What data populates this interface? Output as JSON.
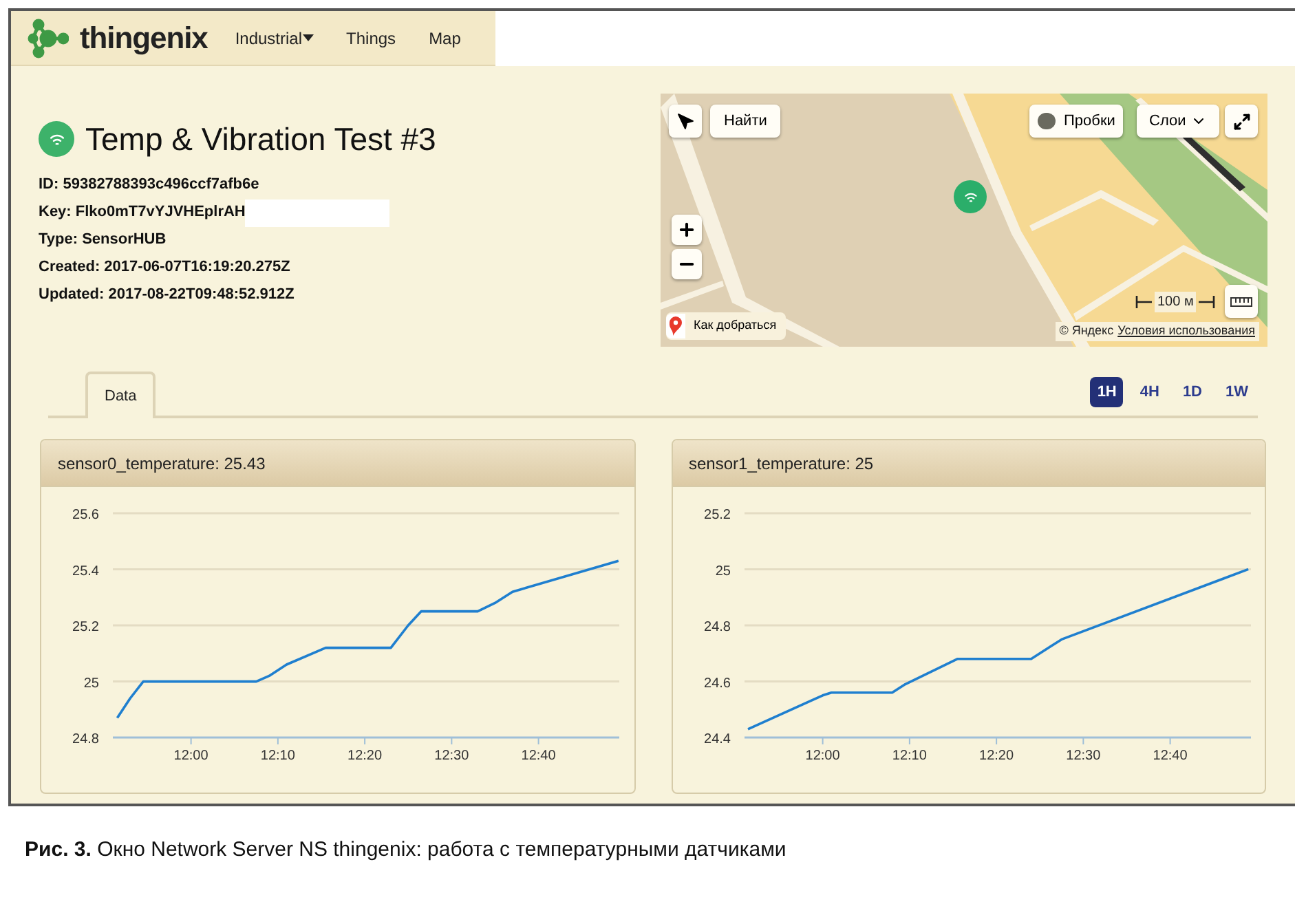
{
  "navbar": {
    "brand": "thingenix",
    "menu": [
      {
        "label": "Industrial",
        "dropdown": true
      },
      {
        "label": "Things",
        "dropdown": false
      },
      {
        "label": "Map",
        "dropdown": false
      }
    ]
  },
  "device": {
    "title": "Temp & Vibration Test #3",
    "online": true,
    "fields": [
      {
        "text": "ID: 59382788393c496ccf7afb6e",
        "redacted": false
      },
      {
        "text": "Key: Flko0mT7vYJVHEplrAH",
        "redacted": true
      },
      {
        "text": "Type: SensorHUB",
        "redacted": false
      },
      {
        "text": "Created: 2017-06-07T16:19:20.275Z",
        "redacted": false
      },
      {
        "text": "Updated: 2017-08-22T09:48:52.912Z",
        "redacted": false
      }
    ]
  },
  "map": {
    "search_button": "Найти",
    "traffic_button": "Пробки",
    "layers_button": "Слои",
    "route_button": "Как добраться",
    "scale": "100 м",
    "copyright": "© Яндекс",
    "terms_link": "Условия использования"
  },
  "tabs": [
    {
      "label": "Data",
      "selected": true
    }
  ],
  "range_buttons": [
    {
      "label": "1H",
      "selected": true
    },
    {
      "label": "4H",
      "selected": false
    },
    {
      "label": "1D",
      "selected": false
    },
    {
      "label": "1W",
      "selected": false
    }
  ],
  "charts": [
    {
      "title": "sensor0_temperature: 25.43",
      "chart_data": {
        "type": "line",
        "grid": true,
        "x": [
          711.5,
          713,
          714.5,
          727.5,
          729,
          731,
          735.5,
          743,
          745,
          746.5,
          753,
          755,
          757,
          769.2
        ],
        "series": [
          {
            "color": "#1f7fcf",
            "values": [
              24.87,
              24.94,
              25.0,
              25.0,
              25.02,
              25.06,
              25.12,
              25.12,
              25.2,
              25.25,
              25.25,
              25.28,
              25.32,
              25.43
            ]
          }
        ],
        "xlim": [
          711,
          769.3
        ],
        "ylim": [
          24.8,
          25.6
        ],
        "yticks": [
          {
            "value": 24.8,
            "label": "24.8"
          },
          {
            "value": 25,
            "label": "25"
          },
          {
            "value": 25.2,
            "label": "25.2"
          },
          {
            "value": 25.4,
            "label": "25.4"
          },
          {
            "value": 25.6,
            "label": "25.6"
          }
        ],
        "xticks": [
          {
            "value": 720,
            "label": "12:00"
          },
          {
            "value": 730,
            "label": "12:10"
          },
          {
            "value": 740,
            "label": "12:20"
          },
          {
            "value": 750,
            "label": "12:30"
          },
          {
            "value": 760,
            "label": "12:40"
          }
        ]
      }
    },
    {
      "title": "sensor1_temperature: 25",
      "chart_data": {
        "type": "line",
        "grid": true,
        "x": [
          711.4,
          720,
          721,
          728,
          729.5,
          735.5,
          744,
          747.5,
          769
        ],
        "series": [
          {
            "color": "#1f7fcf",
            "values": [
              24.43,
              24.55,
              24.56,
              24.56,
              24.59,
              24.68,
              24.68,
              24.75,
              25.0
            ]
          }
        ],
        "xlim": [
          711,
          769.3
        ],
        "ylim": [
          24.4,
          25.2
        ],
        "yticks": [
          {
            "value": 24.4,
            "label": "24.4"
          },
          {
            "value": 24.6,
            "label": "24.6"
          },
          {
            "value": 24.8,
            "label": "24.8"
          },
          {
            "value": 25,
            "label": "25"
          },
          {
            "value": 25.2,
            "label": "25.2"
          }
        ],
        "xticks": [
          {
            "value": 720,
            "label": "12:00"
          },
          {
            "value": 730,
            "label": "12:10"
          },
          {
            "value": 740,
            "label": "12:20"
          },
          {
            "value": 750,
            "label": "12:30"
          },
          {
            "value": 760,
            "label": "12:40"
          }
        ]
      }
    }
  ],
  "caption": "**Рис. 3.** Окно Network Server NS thingenix: работа с температурными датчиками"
}
